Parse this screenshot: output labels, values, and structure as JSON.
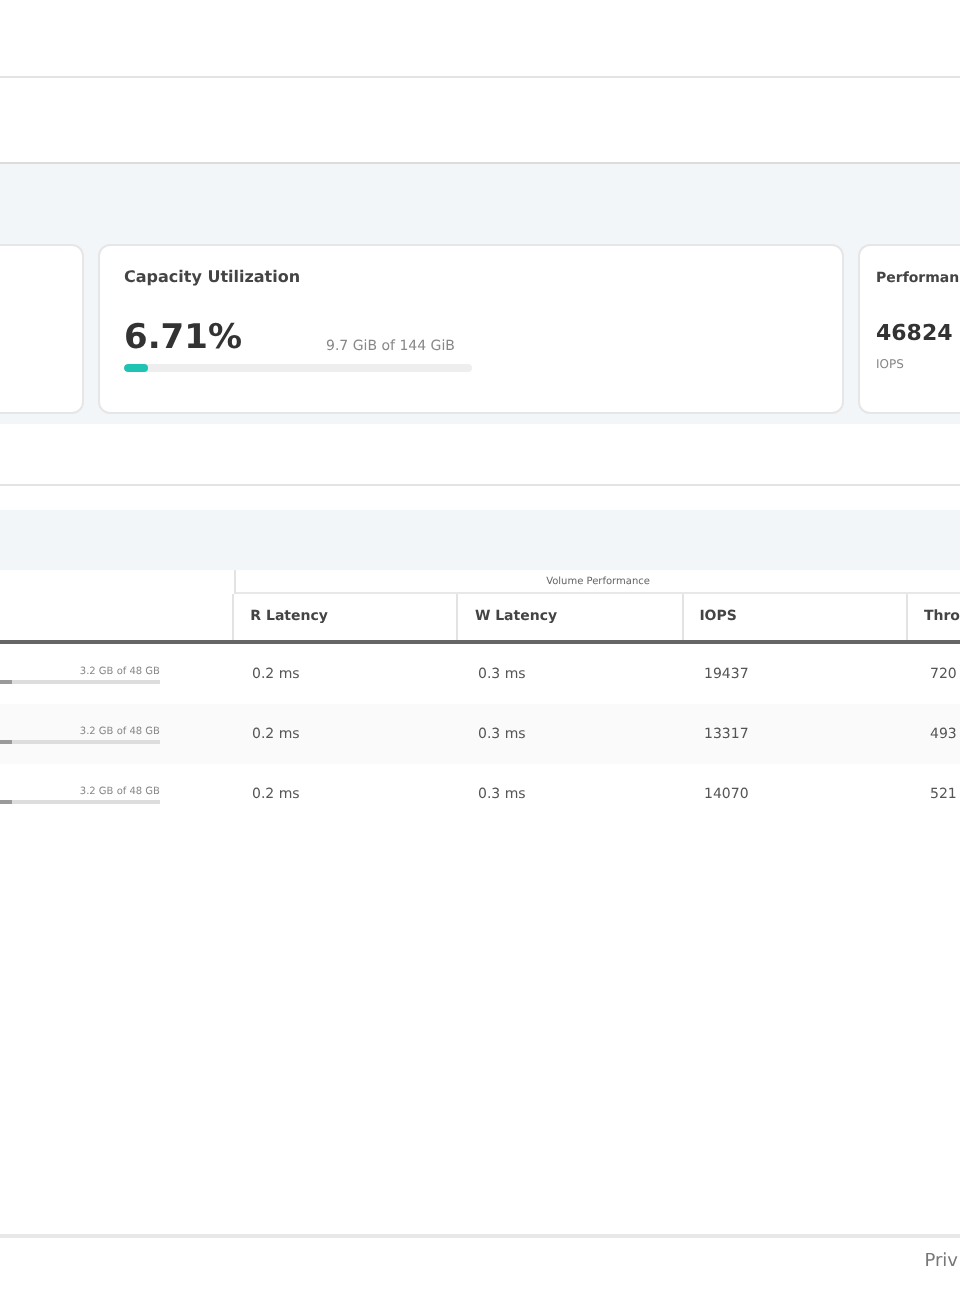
{
  "cards": [
    {
      "title": "Capacity Utilization",
      "value": "6.71%",
      "detail": "9.7 GiB of 144 GiB",
      "level": 0.07
    },
    {
      "title": "Performan",
      "value": "46824",
      "caption": "IOPS"
    }
  ],
  "table": {
    "group_header": "Volume Performance",
    "columns": [
      "R Latency",
      "W Latency",
      "IOPS",
      "Thro"
    ],
    "rows": [
      {
        "capacity": "3.2 GB of 48 GB",
        "level": 0.07,
        "cells": [
          "0.2 ms",
          "0.3 ms",
          "19437",
          "720"
        ]
      },
      {
        "capacity": "3.2 GB of 48 GB",
        "level": 0.07,
        "cells": [
          "0.2 ms",
          "0.3 ms",
          "13317",
          "493"
        ]
      },
      {
        "capacity": "3.2 GB of 48 GB",
        "level": 0.07,
        "cells": [
          "0.2 ms",
          "0.3 ms",
          "14070",
          "521"
        ]
      }
    ]
  },
  "footer": {
    "link": "Priv"
  }
}
